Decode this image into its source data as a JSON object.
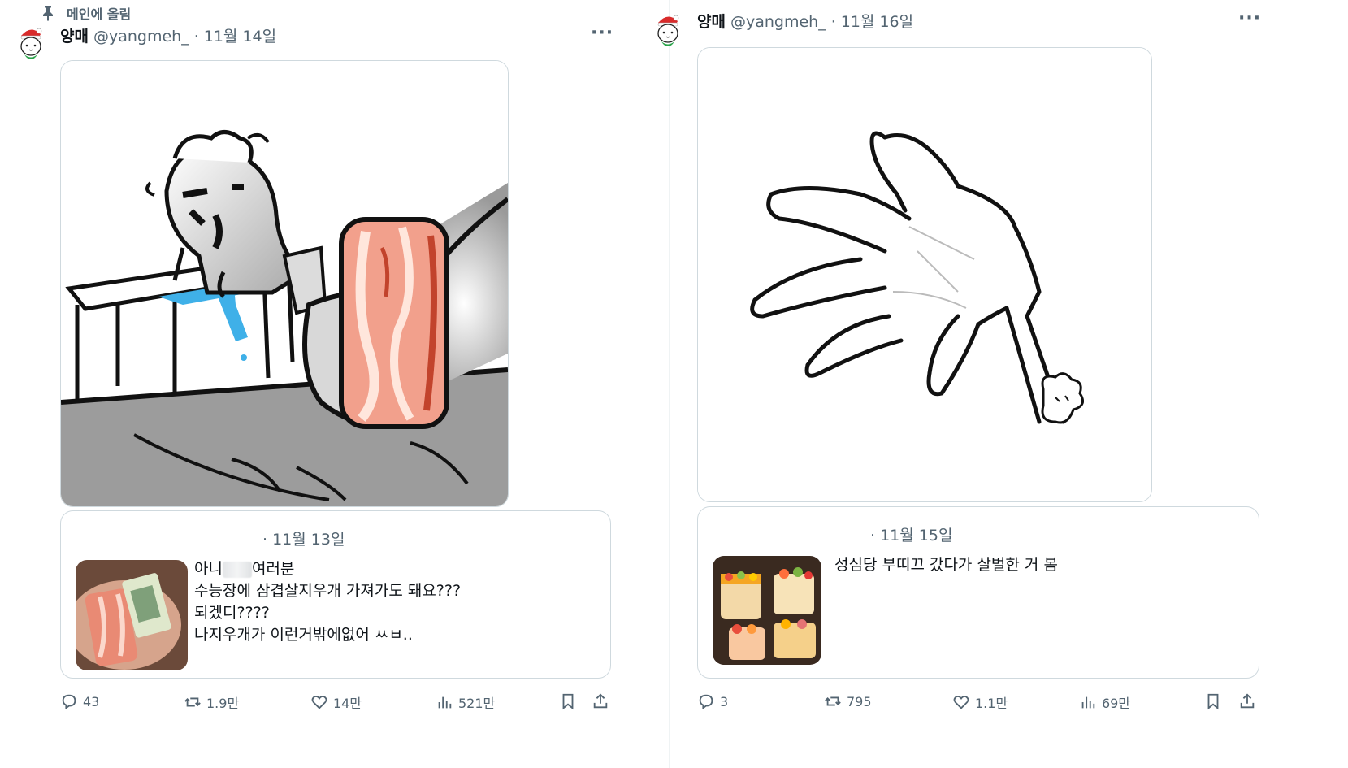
{
  "left": {
    "pinned_label": "메인에 올림",
    "author": {
      "name": "양매",
      "handle": "@yangmeh_",
      "dot": "·",
      "date": "11월 14일"
    },
    "more": "···",
    "quote": {
      "dot": "·",
      "date": "11월 13일",
      "line1_start": "아니",
      "line1_end": "여러분",
      "line2": "수능장에 삼겹살지우개 가져가도 돼요???",
      "line3": "되겠디????",
      "line4": "나지우개가 이런거밖에없어 ㅆㅂ.."
    },
    "actions": {
      "replies": "43",
      "reposts": "1.9만",
      "likes": "14만",
      "views": "521만"
    }
  },
  "right": {
    "author": {
      "name": "양매",
      "handle": "@yangmeh_",
      "dot": "·",
      "date": "11월 16일"
    },
    "more": "···",
    "quote": {
      "dot": "·",
      "date": "11월 15일",
      "text": "성심당 부띠끄 갔다가 살벌한 거 봄"
    },
    "actions": {
      "replies": "3",
      "reposts": "795",
      "likes": "1.1만",
      "views": "69만"
    }
  },
  "colors": {
    "text_primary": "#0f1419",
    "text_secondary": "#536471",
    "border": "#cfd9de",
    "accent_blue": "#1d9bf0"
  }
}
